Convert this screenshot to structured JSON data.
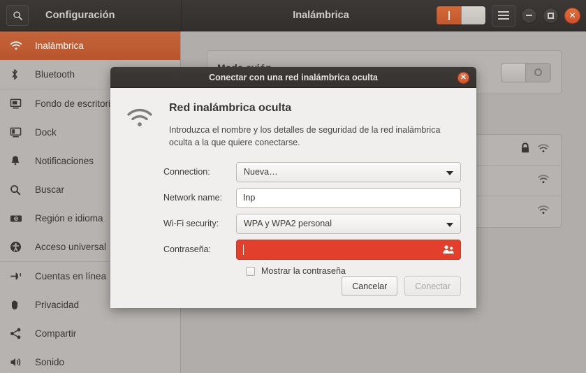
{
  "window": {
    "app_title": "Configuración",
    "panel_title": "Inalámbrica",
    "search_icon": "search-icon",
    "menu_icon": "hamburger-menu-icon",
    "minimize_icon": "minimize-icon",
    "maximize_icon": "maximize-icon",
    "close_icon": "close-icon",
    "wifi_switch_state": "on",
    "accent_color": "#c1572c",
    "headerbar_color": "#35312f"
  },
  "sidebar": {
    "items": [
      {
        "label": "Inalámbrica",
        "icon": "wifi-icon",
        "selected": true,
        "sep_after": false
      },
      {
        "label": "Bluetooth",
        "icon": "bluetooth-icon",
        "selected": false,
        "sep_after": true
      },
      {
        "label": "Fondo de escritorio",
        "icon": "desktop-background-icon",
        "selected": false,
        "sep_after": false
      },
      {
        "label": "Dock",
        "icon": "dock-icon",
        "selected": false,
        "sep_after": false
      },
      {
        "label": "Notificaciones",
        "icon": "bell-icon",
        "selected": false,
        "sep_after": false
      },
      {
        "label": "Buscar",
        "icon": "search-icon",
        "selected": false,
        "sep_after": false
      },
      {
        "label": "Región e idioma",
        "icon": "region-language-icon",
        "selected": false,
        "sep_after": false
      },
      {
        "label": "Acceso universal",
        "icon": "accessibility-icon",
        "selected": false,
        "sep_after": true
      },
      {
        "label": "Cuentas en línea",
        "icon": "online-accounts-icon",
        "selected": false,
        "sep_after": false
      },
      {
        "label": "Privacidad",
        "icon": "privacy-hand-icon",
        "selected": false,
        "sep_after": false
      },
      {
        "label": "Compartir",
        "icon": "share-icon",
        "selected": false,
        "sep_after": false
      },
      {
        "label": "Sonido",
        "icon": "sound-icon",
        "selected": false,
        "sep_after": false
      }
    ]
  },
  "content": {
    "airplane_panel": {
      "title": "Modo avión",
      "subtitle": "na",
      "switch_state": "off"
    },
    "network_rows": [
      {
        "secured": true,
        "lock_icon": "lock-icon",
        "signal_icon": "wifi-signal-icon"
      },
      {
        "secured": false,
        "lock_icon": "",
        "signal_icon": "wifi-signal-icon"
      },
      {
        "secured": false,
        "lock_icon": "",
        "signal_icon": "wifi-signal-icon"
      }
    ]
  },
  "dialog": {
    "titlebar": "Conectar con una red inalámbrica oculta",
    "close_icon": "close-icon",
    "wifi_icon": "wifi-icon",
    "heading": "Red inalámbrica oculta",
    "description": "Introduzca el nombre y los detalles de seguridad de la red inalámbrica oculta a la que quiere conectarse.",
    "fields": {
      "connection": {
        "label": "Connection:",
        "value": "Nueva…",
        "arrow_icon": "chevron-down-icon"
      },
      "network_name": {
        "label": "Network name:",
        "value": "Inp",
        "placeholder": ""
      },
      "wifi_security": {
        "label": "Wi-Fi security:",
        "value": "WPA y WPA2 personal",
        "arrow_icon": "chevron-down-icon"
      },
      "password": {
        "label": "Contraseña:",
        "value": "",
        "error": true,
        "error_color": "#e2402c",
        "trailing_icon": "people-icon"
      }
    },
    "show_password": {
      "label": "Mostrar la contraseña",
      "checked": false
    },
    "buttons": {
      "cancel": "Cancelar",
      "connect": "Conectar",
      "connect_disabled": true
    }
  }
}
